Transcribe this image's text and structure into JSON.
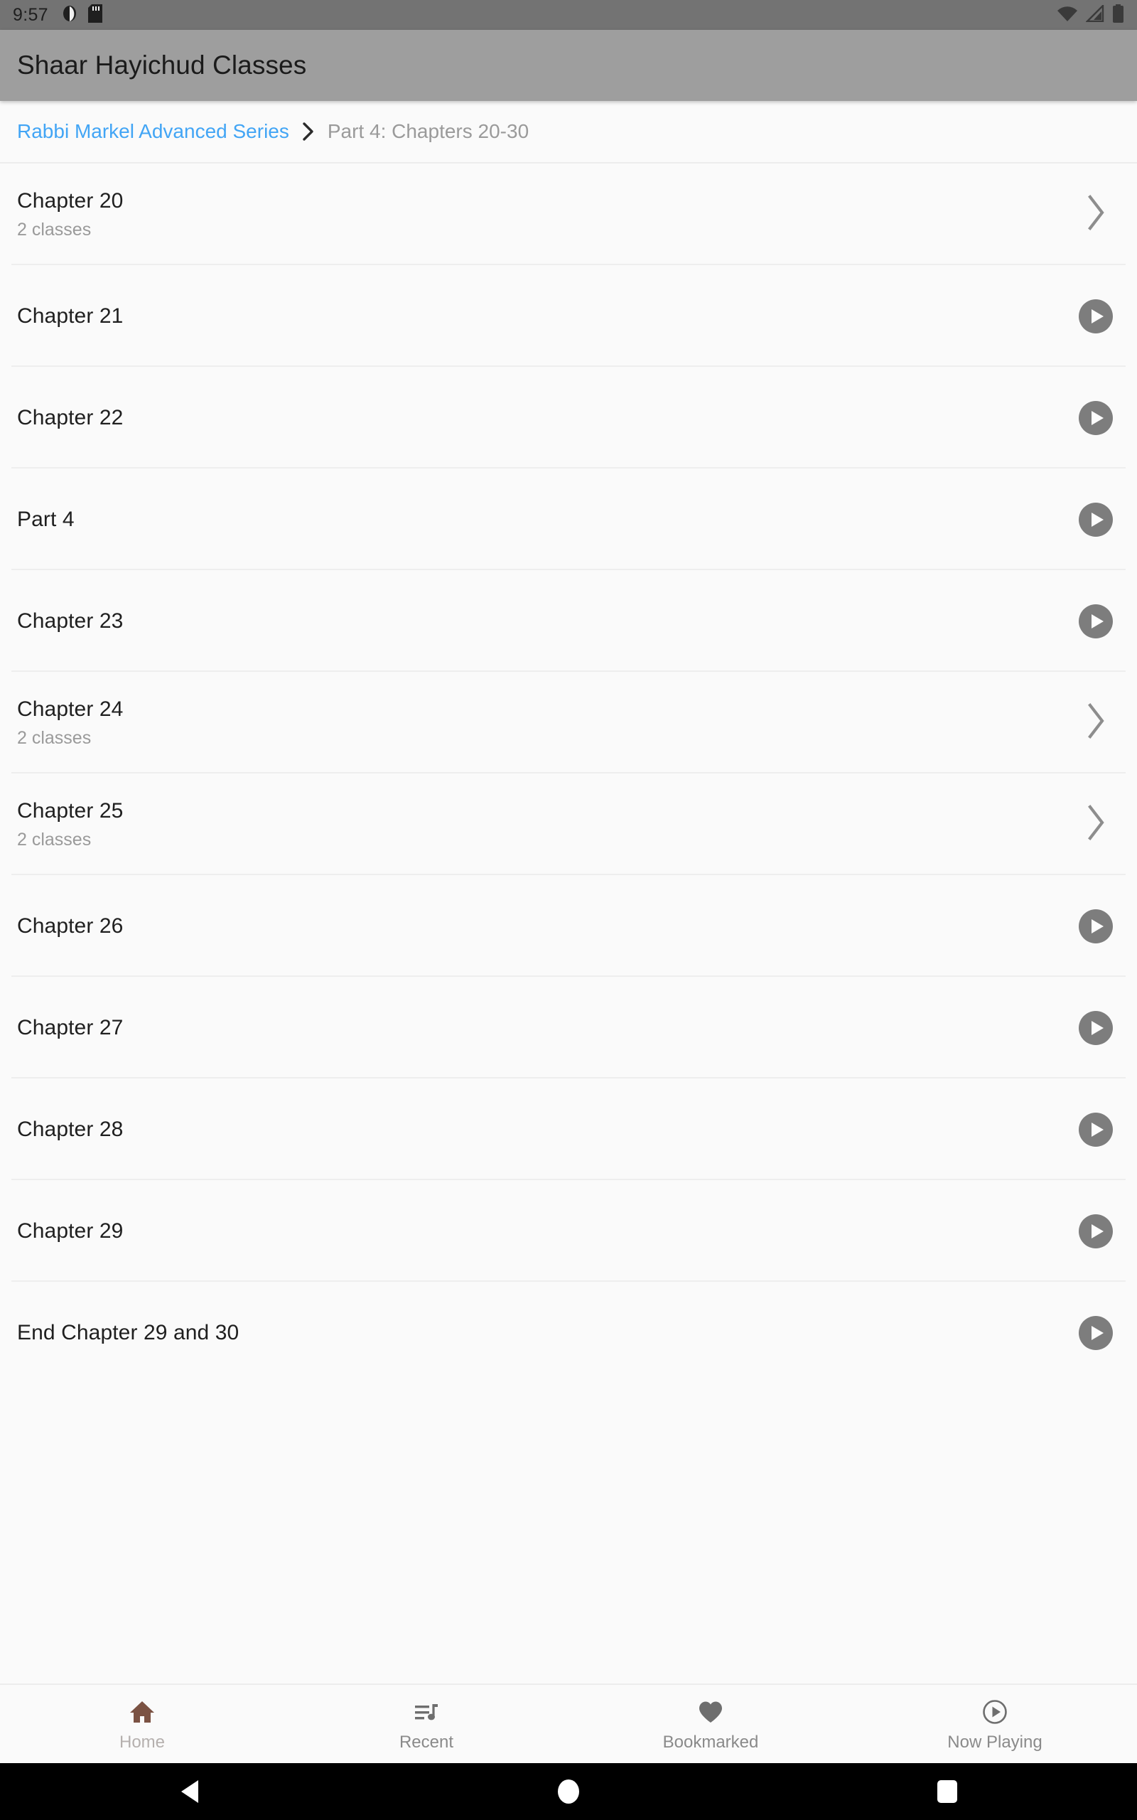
{
  "status_bar": {
    "time": "9:57",
    "left_icons": [
      "do-not-disturb-icon",
      "sd-card-icon"
    ],
    "right_icons": [
      "wifi-icon",
      "cellular-signal-icon",
      "battery-icon"
    ],
    "background": "#737373"
  },
  "app_bar": {
    "title": "Shaar Hayichud Classes",
    "background": "#9e9e9e"
  },
  "breadcrumb": {
    "link_label": "Rabbi Markel Advanced Series",
    "separator_icon": "chevron-right-icon",
    "current_label": "Part 4: Chapters 20-30",
    "link_color": "#42a5f5",
    "current_color": "#9a9a9a"
  },
  "list": {
    "items": [
      {
        "title": "Chapter 20",
        "subtitle": "2 classes",
        "action": "chevron-right-icon"
      },
      {
        "title": "Chapter 21",
        "subtitle": "",
        "action": "play-circle-icon"
      },
      {
        "title": "Chapter 22",
        "subtitle": "",
        "action": "play-circle-icon"
      },
      {
        "title": "Part 4",
        "subtitle": "",
        "action": "play-circle-icon"
      },
      {
        "title": "Chapter 23",
        "subtitle": "",
        "action": "play-circle-icon"
      },
      {
        "title": "Chapter 24",
        "subtitle": "2 classes",
        "action": "chevron-right-icon"
      },
      {
        "title": "Chapter 25",
        "subtitle": "2 classes",
        "action": "chevron-right-icon"
      },
      {
        "title": "Chapter 26",
        "subtitle": "",
        "action": "play-circle-icon"
      },
      {
        "title": "Chapter 27",
        "subtitle": "",
        "action": "play-circle-icon"
      },
      {
        "title": "Chapter 28",
        "subtitle": "",
        "action": "play-circle-icon"
      },
      {
        "title": "Chapter 29",
        "subtitle": "",
        "action": "play-circle-icon"
      },
      {
        "title": "End Chapter 29 and 30",
        "subtitle": "",
        "action": "play-circle-icon"
      }
    ]
  },
  "bottom_nav": {
    "items": [
      {
        "label": "Home",
        "icon": "home-icon",
        "active": true,
        "icon_color": "#7b5243"
      },
      {
        "label": "Recent",
        "icon": "playlist-music-icon",
        "active": false,
        "icon_color": "#6e6e6e"
      },
      {
        "label": "Bookmarked",
        "icon": "heart-icon",
        "active": false,
        "icon_color": "#6e6e6e"
      },
      {
        "label": "Now Playing",
        "icon": "play-circle-outline-icon",
        "active": false,
        "icon_color": "#6e6e6e"
      }
    ]
  },
  "system_nav": {
    "back_label": "back-button",
    "home_label": "home-button",
    "recents_label": "recents-button"
  }
}
